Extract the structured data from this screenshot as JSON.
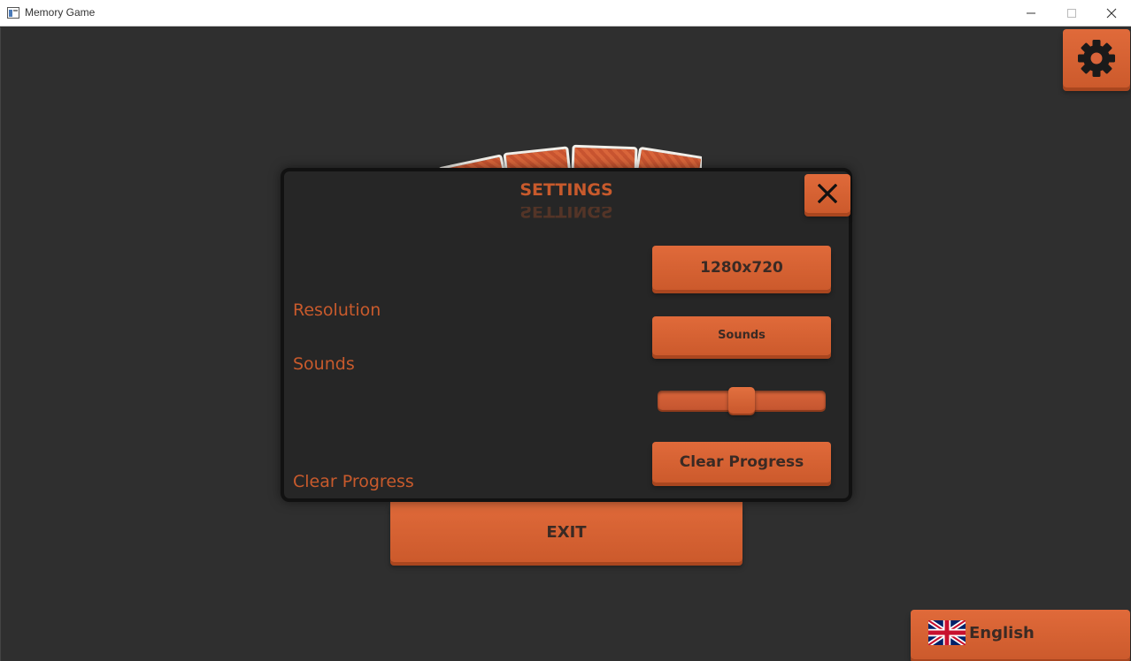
{
  "window": {
    "title": "Memory Game"
  },
  "settings": {
    "title": "SETTINGS",
    "rows": {
      "resolution_label": "Resolution",
      "sounds_label": "Sounds",
      "clear_progress_label": "Clear Progress"
    },
    "resolution_value": "1280x720",
    "sounds_button": "Sounds",
    "volume_level": 0.5,
    "clear_progress_button": "Clear Progress"
  },
  "menu": {
    "exit_label": "EXIT"
  },
  "language": {
    "label": "English",
    "flag": "uk-flag-icon"
  },
  "colors": {
    "accent": "#d9643a",
    "accent_text": "#c85a2c",
    "background": "#2f2f2f",
    "dialog_bg": "#262626"
  }
}
